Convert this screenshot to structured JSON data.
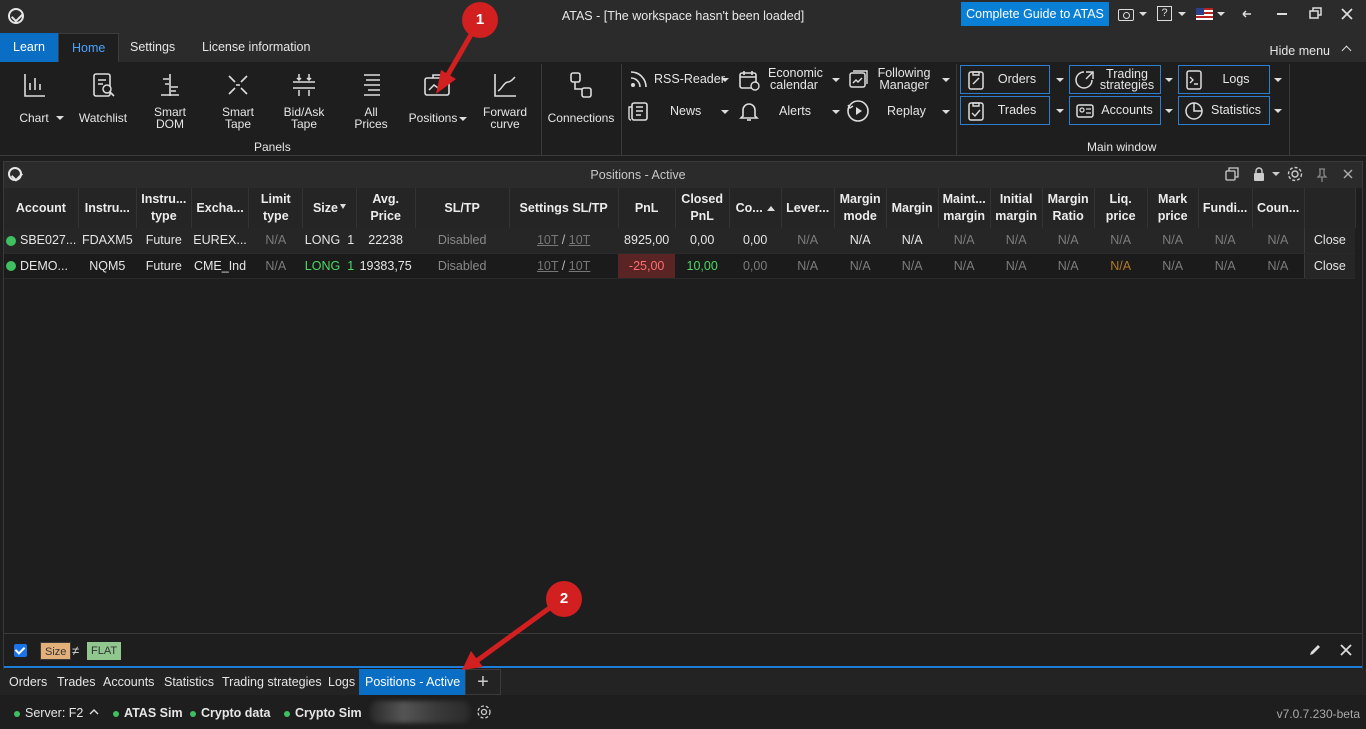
{
  "window": {
    "title": "ATAS - [The workspace hasn't been loaded]",
    "guide_button": "Complete Guide to ATAS",
    "help_label": "?"
  },
  "menu": {
    "tabs": [
      "Learn",
      "Home",
      "Settings",
      "License information"
    ],
    "hide_menu": "Hide menu"
  },
  "ribbon": {
    "panels_group": "Panels",
    "main_window_group": "Main window",
    "buttons": {
      "chart": "Chart",
      "watchlist": "Watchlist",
      "smart_dom": [
        "Smart",
        "DOM"
      ],
      "smart_tape": [
        "Smart",
        "Tape"
      ],
      "bid_ask_tape": [
        "Bid/Ask",
        "Tape"
      ],
      "all_prices": [
        "All",
        "Prices"
      ],
      "positions": "Positions",
      "forward_curve": [
        "Forward",
        "curve"
      ],
      "connections": "Connections",
      "rss_reader": "RSS-Reader",
      "news": "News",
      "economic_calendar": [
        "Economic",
        "calendar"
      ],
      "alerts": "Alerts",
      "following_manager": [
        "Following",
        "Manager"
      ],
      "replay": "Replay",
      "orders": "Orders",
      "trades": "Trades",
      "trading_strategies": [
        "Trading",
        "strategies"
      ],
      "accounts": "Accounts",
      "logs": "Logs",
      "statistics": "Statistics"
    }
  },
  "panel": {
    "title": "Positions - Active",
    "columns": [
      [
        "",
        "Account"
      ],
      [
        "",
        "Instru..."
      ],
      [
        "Instru...",
        "type"
      ],
      [
        "",
        "Excha..."
      ],
      [
        "Limit",
        "type"
      ],
      [
        "",
        "Size"
      ],
      [
        "Avg.",
        "Price"
      ],
      [
        "",
        "SL/TP"
      ],
      [
        "",
        "Settings SL/TP"
      ],
      [
        "",
        "PnL"
      ],
      [
        "Closed",
        "PnL"
      ],
      [
        "",
        "Co..."
      ],
      [
        "",
        "Lever..."
      ],
      [
        "Margin",
        "mode"
      ],
      [
        "",
        "Margin"
      ],
      [
        "Maint...",
        "margin"
      ],
      [
        "Initial",
        "margin"
      ],
      [
        "Margin",
        "Ratio"
      ],
      [
        "Liq.",
        "price"
      ],
      [
        "Mark",
        "price"
      ],
      [
        "",
        "Fundi..."
      ],
      [
        "",
        "Coun..."
      ],
      [
        "",
        ""
      ]
    ],
    "rows": [
      {
        "account": "SBE027...",
        "instrument": "FDAXM5",
        "type": "Future",
        "exchange": "EUREX...",
        "limit_type": "N/A",
        "size": "LONG",
        "size_qty": "1",
        "avg_price": "22238",
        "sl_tp": "Disabled",
        "settings_sl": "10T",
        "settings_tp": "10T",
        "pnl": "8925,00",
        "closed_pnl": "0,00",
        "commission": "0,00",
        "leverage": "N/A",
        "margin_mode": "N/A",
        "margin": "N/A",
        "maint_margin": "N/A",
        "initial_margin": "N/A",
        "margin_ratio": "N/A",
        "liq_price": "N/A",
        "mark_price": "N/A",
        "funding": "N/A",
        "counter": "N/A",
        "close": "Close"
      },
      {
        "account": "DEMO...",
        "instrument": "NQM5",
        "type": "Future",
        "exchange": "CME_Ind",
        "limit_type": "N/A",
        "size": "LONG",
        "size_qty": "1",
        "avg_price": "19383,75",
        "sl_tp": "Disabled",
        "settings_sl": "10T",
        "settings_tp": "10T",
        "pnl": "-25,00",
        "closed_pnl": "10,00",
        "commission": "0,00",
        "leverage": "N/A",
        "margin_mode": "N/A",
        "margin": "N/A",
        "maint_margin": "N/A",
        "initial_margin": "N/A",
        "margin_ratio": "N/A",
        "liq_price": "N/A",
        "mark_price": "N/A",
        "funding": "N/A",
        "counter": "N/A",
        "close": "Close"
      }
    ],
    "filter": {
      "field": "Size",
      "op": "≠",
      "value": "FLAT"
    }
  },
  "bottom_tabs": [
    "Orders",
    "Trades",
    "Accounts",
    "Statistics",
    "Trading strategies",
    "Logs",
    "Positions - Active"
  ],
  "status": {
    "server": "Server: F2",
    "connections": [
      "ATAS Sim",
      "Crypto data",
      "Crypto Sim"
    ],
    "version": "v7.0.7.230-beta"
  },
  "annotations": [
    "1",
    "2"
  ],
  "colors": {
    "accent": "#0a7fd6",
    "positive": "#4cd964",
    "negative": "#ff6f6f",
    "annotation": "#d21f1f"
  }
}
